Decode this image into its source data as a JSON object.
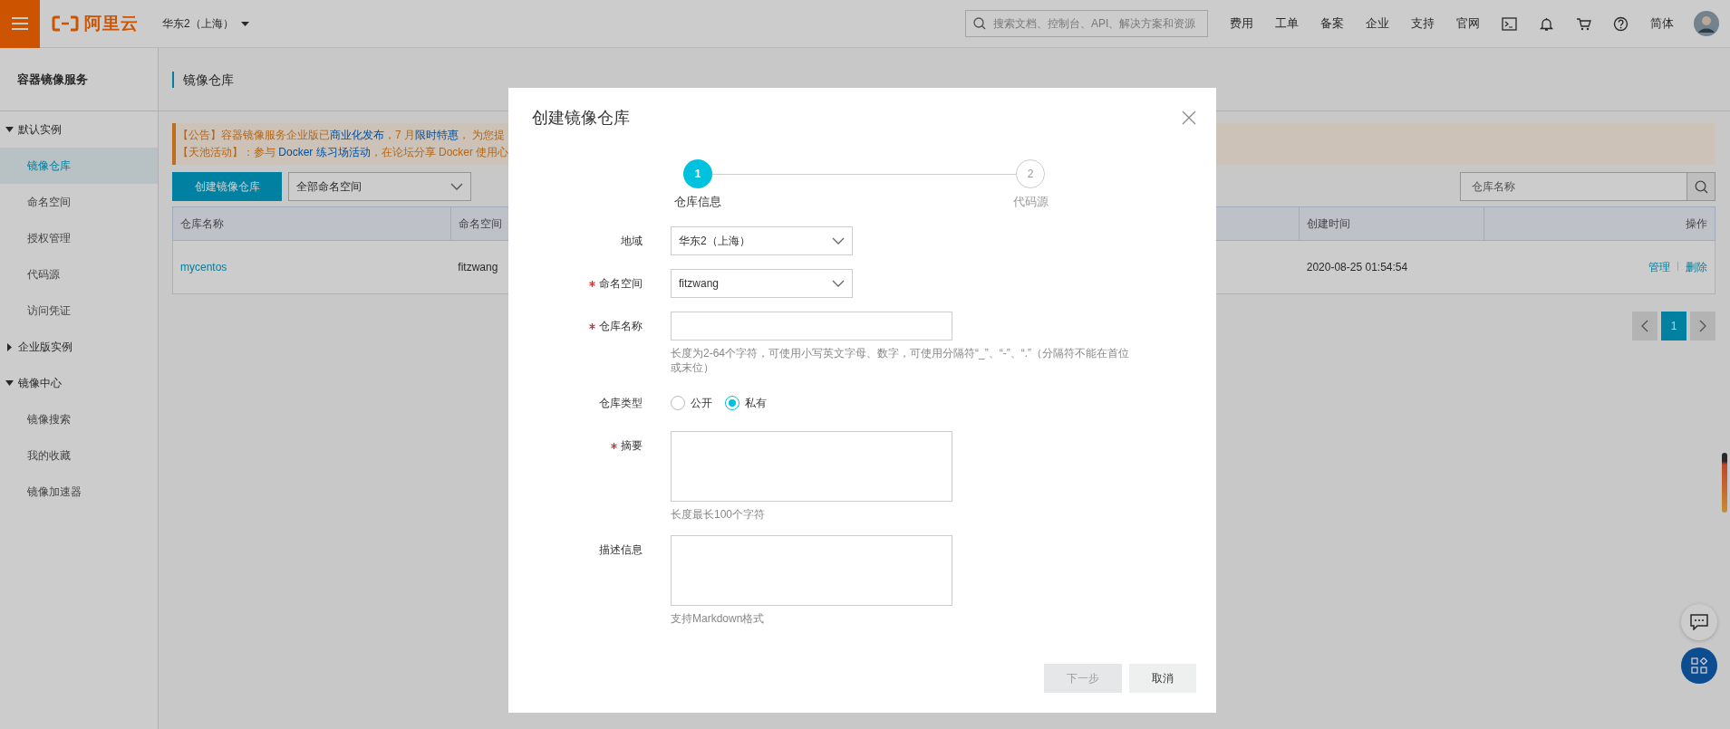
{
  "topbar": {
    "logo_text": "阿里云",
    "region": "华东2（上海）",
    "search": {
      "placeholder": "搜索文档、控制台、API、解决方案和资源"
    },
    "nav": [
      "费用",
      "工单",
      "备案",
      "企业",
      "支持",
      "官网"
    ],
    "language": "简体"
  },
  "sidebar": {
    "title": "容器镜像服务",
    "groups": [
      {
        "label": "默认实例",
        "expanded": true,
        "children": [
          {
            "label": "镜像仓库",
            "selected": true
          },
          {
            "label": "命名空间",
            "selected": false
          },
          {
            "label": "授权管理",
            "selected": false
          },
          {
            "label": "代码源",
            "selected": false
          },
          {
            "label": "访问凭证",
            "selected": false
          }
        ]
      },
      {
        "label": "企业版实例",
        "expanded": false
      },
      {
        "label": "镜像中心",
        "expanded": true,
        "children": [
          {
            "label": "镜像搜索",
            "selected": false
          },
          {
            "label": "我的收藏",
            "selected": false
          },
          {
            "label": "镜像加速器",
            "selected": false
          }
        ]
      }
    ]
  },
  "page": {
    "title": "镜像仓库",
    "announcements": [
      {
        "segments": [
          {
            "kind": "plain",
            "text": "【公告】容器镜像服务企业版已"
          },
          {
            "kind": "link",
            "text": "商业化发布"
          },
          {
            "kind": "plain",
            "text": "，7 月"
          },
          {
            "kind": "link",
            "text": "限时特惠"
          },
          {
            "kind": "plain",
            "text": "， 为您提"
          }
        ]
      },
      {
        "segments": [
          {
            "kind": "plain",
            "text": "【天池活动】：参与 "
          },
          {
            "kind": "link",
            "text": "Docker 练习场活动"
          },
          {
            "kind": "plain",
            "text": "，在论坛分享 Docker 使用心"
          }
        ]
      }
    ],
    "create_button": "创建镜像仓库",
    "namespace_filter": {
      "value": "全部命名空间"
    },
    "search": {
      "placeholder": "仓库名称"
    },
    "table": {
      "columns": [
        "仓库名称",
        "命名空间",
        "创建时间",
        "操作"
      ],
      "rows": [
        {
          "name": "mycentos",
          "namespace": "fitzwang",
          "created": "2020-08-25 01:54:54",
          "actions": [
            "管理",
            "删除"
          ]
        }
      ]
    },
    "pagination": {
      "pages": [
        {
          "label": "1",
          "selected": true
        }
      ]
    }
  },
  "dialog": {
    "title": "创建镜像仓库",
    "steps": [
      {
        "number": "1",
        "label": "仓库信息",
        "selected": true
      },
      {
        "number": "2",
        "label": "代码源",
        "selected": false
      }
    ],
    "fields": [
      {
        "kind": "select",
        "label": "地域",
        "required": false,
        "value": "华东2（上海）"
      },
      {
        "kind": "select",
        "label": "命名空间",
        "required": true,
        "value": "fitzwang"
      },
      {
        "kind": "input",
        "label": "仓库名称",
        "required": true,
        "hint": "长度为2-64个字符，可使用小写英文字母、数字，可使用分隔符“_”、“-”、“.”（分隔符不能在首位或末位）"
      },
      {
        "kind": "radio",
        "label": "仓库类型",
        "required": false,
        "options": [
          {
            "label": "公开",
            "selected": false
          },
          {
            "label": "私有",
            "selected": true
          }
        ]
      },
      {
        "kind": "textarea",
        "label": "摘要",
        "required": true,
        "hint": "长度最长100个字符"
      },
      {
        "kind": "textarea",
        "label": "描述信息",
        "required": false,
        "hint": "支持Markdown格式"
      }
    ],
    "buttons": [
      {
        "label": "下一步",
        "disabled": true
      },
      {
        "label": "取消",
        "disabled": false
      }
    ]
  }
}
